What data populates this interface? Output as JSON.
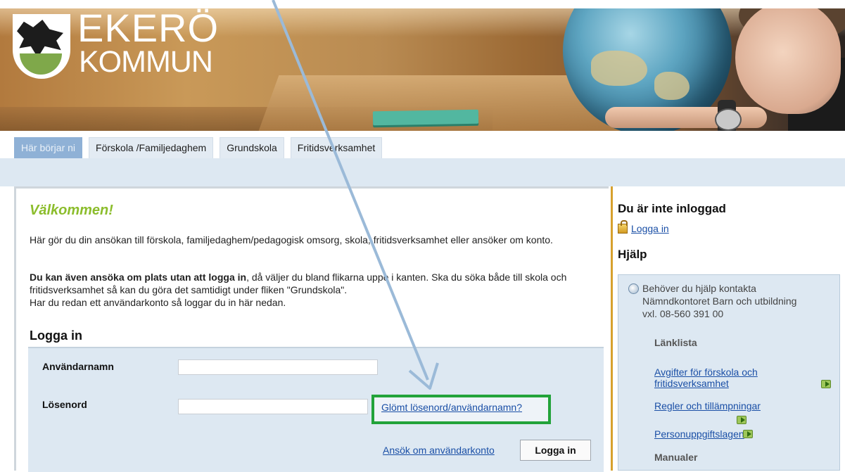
{
  "logo": {
    "line1": "EKERÖ",
    "line2": "KOMMUN"
  },
  "tabs": [
    {
      "label": "Här börjar ni",
      "active": true
    },
    {
      "label": "Förskola /Familjedaghem",
      "active": false
    },
    {
      "label": "Grundskola",
      "active": false
    },
    {
      "label": "Fritidsverksamhet",
      "active": false
    }
  ],
  "main": {
    "title": "Välkommen!",
    "intro": "Här gör du din ansökan till förskola, familjedaghem/pedagogisk omsorg, skola, fritidsverksamhet eller ansöker om konto.",
    "bold_lead": "Du kan även ansöka om plats utan att logga in",
    "rest_1": ", då väljer du bland flikarna uppe i kanten. Ska du söka både till skola och fritidsverksamhet så kan du göra det samtidigt under fliken \"Grundskola\".",
    "rest_2": "Har du redan ett användarkonto så loggar du in här nedan."
  },
  "login": {
    "title": "Logga in",
    "username_label": "Användarnamn",
    "password_label": "Lösenord",
    "username_value": "",
    "password_value": "",
    "forgot_link": "Glömt lösenord/användarnamn?",
    "apply_link": "Ansök om användarkonto",
    "submit_label": "Logga in"
  },
  "sidebar": {
    "status": "Du är inte inloggad",
    "login_link": "Logga in",
    "help_title": "Hjälp",
    "help_text": "Behöver du hjälp kontakta Nämndkontoret Barn och utbildning vxl. 08-560 391 00",
    "linklist_title": "Länklista",
    "links": [
      "Avgifter för förskola och fritidsverksamhet",
      "Regler och tillämpningar",
      "Personuppgiftslagen"
    ],
    "manuals_title": "Manualer"
  },
  "annotation": {
    "arrow_color": "#9bbad8",
    "highlight_color": "#22a33a"
  },
  "colors": {
    "accent_green": "#8cbd2c",
    "link": "#1a4fa6",
    "tab_active": "#8fb1d6",
    "panel_blue": "#dde8f2"
  }
}
